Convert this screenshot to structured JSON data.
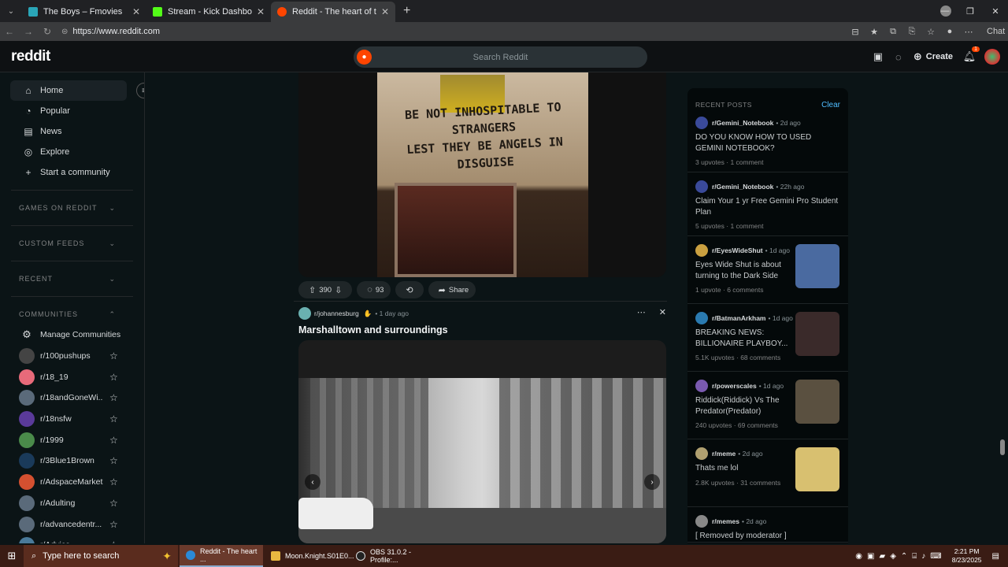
{
  "browser": {
    "tabs": [
      {
        "label": "The Boys – Fmovies",
        "color": "#2aa6b8"
      },
      {
        "label": "Stream - Kick Dashboard",
        "color": "#53fc18"
      },
      {
        "label": "Reddit - The heart of the internet",
        "color": "#ff4500"
      }
    ],
    "url": "https://www.reddit.com",
    "chat_label": "Chat"
  },
  "header": {
    "logo": "reddit",
    "search_placeholder": "Search Reddit",
    "create_label": "Create",
    "notif_count": "1"
  },
  "sidebar": {
    "nav": [
      {
        "label": "Home",
        "icon": "home-icon"
      },
      {
        "label": "Popular",
        "icon": "popular-icon"
      },
      {
        "label": "News",
        "icon": "news-icon"
      },
      {
        "label": "Explore",
        "icon": "explore-icon"
      },
      {
        "label": "Start a community",
        "icon": "plus-icon"
      }
    ],
    "sections": {
      "games": "GAMES ON REDDIT",
      "custom": "CUSTOM FEEDS",
      "recent": "RECENT",
      "communities": "COMMUNITIES"
    },
    "manage_label": "Manage Communities",
    "communities": [
      {
        "name": "r/100pushups",
        "color": "#444"
      },
      {
        "name": "r/18_19",
        "color": "#e86a7a"
      },
      {
        "name": "r/18andGoneWi...",
        "color": "#5a6a7a"
      },
      {
        "name": "r/18nsfw",
        "color": "#5a3a9a"
      },
      {
        "name": "r/1999",
        "color": "#4a8a4a"
      },
      {
        "name": "r/3Blue1Brown",
        "color": "#1a3a5a"
      },
      {
        "name": "r/AdspaceMarket",
        "color": "#d45030"
      },
      {
        "name": "r/Adulting",
        "color": "#5a6a7a"
      },
      {
        "name": "r/advancedentr...",
        "color": "#5a6a7a"
      },
      {
        "name": "r/Advice",
        "color": "#4a7a9a"
      }
    ]
  },
  "feed": {
    "post1": {
      "image_quote_line1": "BE NOT INHOSPITABLE TO STRANGERS",
      "image_quote_line2": "LEST THEY BE ANGELS IN DISGUISE",
      "votes": "390",
      "comments": "93",
      "share_label": "Share"
    },
    "post2": {
      "subreddit": "r/johannesburg",
      "time": "1 day ago",
      "title": "Marshalltown and surroundings"
    }
  },
  "recent_posts": {
    "title": "RECENT POSTS",
    "clear_label": "Clear",
    "items": [
      {
        "sub": "r/Gemini_Notebook",
        "time": "2d ago",
        "title": "DO YOU KNOW HOW TO USED GEMINI NOTEBOOK?",
        "upvotes": "3 upvotes",
        "comments": "1 comment",
        "color": "#3a4a9a",
        "thumb": ""
      },
      {
        "sub": "r/Gemini_Notebook",
        "time": "22h ago",
        "title": "Claim Your 1 yr Free Gemini Pro Student Plan",
        "upvotes": "5 upvotes",
        "comments": "1 comment",
        "color": "#3a4a9a",
        "thumb": ""
      },
      {
        "sub": "r/EyesWideShut",
        "time": "1d ago",
        "title": "Eyes Wide Shut is about turning to the Dark Side",
        "upvotes": "1 upvote",
        "comments": "6 comments",
        "color": "#caa040",
        "thumb": "#4a6aa0"
      },
      {
        "sub": "r/BatmanArkham",
        "time": "1d ago",
        "title": "BREAKING NEWS: BILLIONAIRE PLAYBOY...",
        "upvotes": "5.1K upvotes",
        "comments": "68 comments",
        "color": "#2a7ab0",
        "thumb": "#3a2a2a"
      },
      {
        "sub": "r/powerscales",
        "time": "1d ago",
        "title": "Riddick(Riddick) Vs The Predator(Predator)",
        "upvotes": "240 upvotes",
        "comments": "69 comments",
        "color": "#7a5ab0",
        "thumb": "#5a5040"
      },
      {
        "sub": "r/meme",
        "time": "2d ago",
        "title": "Thats me lol",
        "upvotes": "2.8K upvotes",
        "comments": "31 comments",
        "color": "#b0a070",
        "thumb": "#d8c070"
      },
      {
        "sub": "r/memes",
        "time": "2d ago",
        "title": "[ Removed by moderator ]",
        "upvotes": "",
        "comments": "",
        "color": "#888",
        "thumb": ""
      }
    ]
  },
  "taskbar": {
    "search_placeholder": "Type here to search",
    "tasks": [
      {
        "label": "Reddit - The heart ...",
        "color": "#2a8ad8"
      },
      {
        "label": "Moon.Knight.S01E0...",
        "color": "#e8b840"
      },
      {
        "label": "OBS 31.0.2 - Profile:...",
        "color": "#333"
      }
    ],
    "time": "2:21 PM",
    "date": "8/23/2025"
  }
}
